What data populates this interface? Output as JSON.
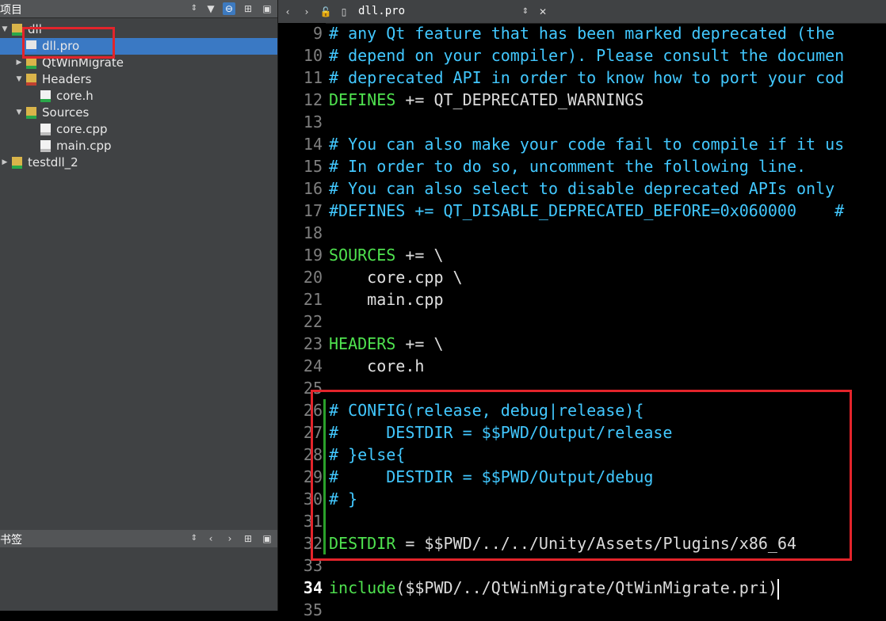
{
  "project_pane": {
    "title": "项目",
    "tree": [
      {
        "label": "dll",
        "level": 0,
        "expanded": true,
        "icon": "project-folder-icon"
      },
      {
        "label": "dll.pro",
        "level": 1,
        "selected": true,
        "icon": "pro-file-icon"
      },
      {
        "label": "QtWinMigrate",
        "level": 1,
        "expanded": false,
        "icon": "pri-folder-icon"
      },
      {
        "label": "Headers",
        "level": 1,
        "expanded": true,
        "icon": "headers-folder-icon"
      },
      {
        "label": "core.h",
        "level": 2,
        "icon": "header-file-icon"
      },
      {
        "label": "Sources",
        "level": 1,
        "expanded": true,
        "icon": "sources-folder-icon"
      },
      {
        "label": "core.cpp",
        "level": 2,
        "icon": "source-file-icon"
      },
      {
        "label": "main.cpp",
        "level": 2,
        "icon": "source-file-icon"
      },
      {
        "label": "testdll_2",
        "level": 0,
        "expanded": false,
        "icon": "project-folder-icon"
      }
    ]
  },
  "bookmarks_pane": {
    "title": "书签"
  },
  "editor": {
    "file_tab": "dll.pro",
    "current_line": 34,
    "lines": [
      {
        "n": "9",
        "segs": [
          {
            "t": "# any Qt feature that has been marked deprecated (the ",
            "c": "cm"
          }
        ]
      },
      {
        "n": "10",
        "segs": [
          {
            "t": "# depend on your compiler). Please consult the documen",
            "c": "cm"
          }
        ]
      },
      {
        "n": "11",
        "segs": [
          {
            "t": "# deprecated API in order to know how to port your cod",
            "c": "cm"
          }
        ]
      },
      {
        "n": "12",
        "segs": [
          {
            "t": "DEFINES",
            "c": "kw"
          },
          {
            "t": " += QT_DEPRECATED_WARNINGS",
            "c": "op"
          }
        ]
      },
      {
        "n": "13",
        "segs": []
      },
      {
        "n": "14",
        "segs": [
          {
            "t": "# You can also make your code fail to compile if it us",
            "c": "cm"
          }
        ]
      },
      {
        "n": "15",
        "segs": [
          {
            "t": "# In order to do so, uncomment the following line.",
            "c": "cm"
          }
        ]
      },
      {
        "n": "16",
        "segs": [
          {
            "t": "# You can also select to disable deprecated APIs only ",
            "c": "cm"
          }
        ]
      },
      {
        "n": "17",
        "segs": [
          {
            "t": "#DEFINES += QT_DISABLE_DEPRECATED_BEFORE=0x060000    #",
            "c": "cm"
          }
        ]
      },
      {
        "n": "18",
        "segs": []
      },
      {
        "n": "19",
        "segs": [
          {
            "t": "SOURCES",
            "c": "kw"
          },
          {
            "t": " += \\",
            "c": "op"
          }
        ]
      },
      {
        "n": "20",
        "segs": [
          {
            "t": "    core.cpp \\",
            "c": "str"
          }
        ]
      },
      {
        "n": "21",
        "segs": [
          {
            "t": "    main.cpp",
            "c": "str"
          }
        ]
      },
      {
        "n": "22",
        "segs": []
      },
      {
        "n": "23",
        "segs": [
          {
            "t": "HEADERS",
            "c": "kw"
          },
          {
            "t": " += \\",
            "c": "op"
          }
        ]
      },
      {
        "n": "24",
        "segs": [
          {
            "t": "    core.h",
            "c": "str"
          }
        ]
      },
      {
        "n": "25",
        "segs": []
      },
      {
        "n": "26",
        "segs": [
          {
            "t": "# CONFIG(release, debug|release){",
            "c": "cm"
          }
        ]
      },
      {
        "n": "27",
        "segs": [
          {
            "t": "#     DESTDIR = $$PWD/Output/release",
            "c": "cm"
          }
        ]
      },
      {
        "n": "28",
        "segs": [
          {
            "t": "# }else{",
            "c": "cm"
          }
        ]
      },
      {
        "n": "29",
        "segs": [
          {
            "t": "#     DESTDIR = $$PWD/Output/debug",
            "c": "cm"
          }
        ]
      },
      {
        "n": "30",
        "segs": [
          {
            "t": "# }",
            "c": "cm"
          }
        ]
      },
      {
        "n": "31",
        "segs": []
      },
      {
        "n": "32",
        "segs": [
          {
            "t": "DESTDIR",
            "c": "kw"
          },
          {
            "t": " = $$PWD/../../Unity/Assets/Plugins/x86_64",
            "c": "op"
          }
        ]
      },
      {
        "n": "33",
        "segs": []
      },
      {
        "n": "34",
        "segs": [
          {
            "t": "include",
            "c": "kw"
          },
          {
            "t": "($$PWD/../QtWinMigrate/QtWinMigrate.pri)",
            "c": "op"
          }
        ]
      },
      {
        "n": "35",
        "segs": []
      }
    ]
  },
  "colors": {
    "comment": "#42c8ff",
    "keyword": "#4fe24f",
    "selection": "#3a79c4",
    "highlight_box": "#e3242b"
  }
}
